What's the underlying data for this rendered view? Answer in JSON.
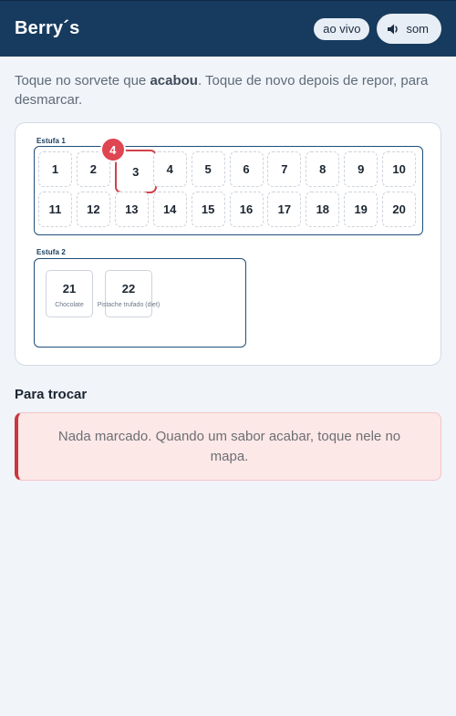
{
  "header": {
    "brand": "Berry´s",
    "live_label": "ao vivo",
    "sound_label": "som",
    "sound_icon": "speaker-icon"
  },
  "instructions": {
    "before": "Toque no sorvete que ",
    "bold": "acabou",
    "after": ". Toque de novo depois de repor, para desmarcar."
  },
  "map": {
    "estufa1": {
      "label": "Estufa 1",
      "cells": [
        "1",
        "2",
        "3",
        "4",
        "5",
        "6",
        "7",
        "8",
        "9",
        "10",
        "11",
        "12",
        "13",
        "14",
        "15",
        "16",
        "17",
        "18",
        "19",
        "20"
      ],
      "selected_cell": "3",
      "selected_badge": "4"
    },
    "estufa2": {
      "label": "Estufa 2",
      "cells": [
        {
          "number": "21",
          "flavor": "Chocolate"
        },
        {
          "number": "22",
          "flavor": "Pistache trufado (diet)"
        }
      ]
    }
  },
  "swap": {
    "title": "Para trocar",
    "empty_message": "Nada marcado. Quando um sabor acabar, toque nele no mapa."
  },
  "colors": {
    "header_bg": "#173b5e",
    "accent_red": "#e04552",
    "estufa_border": "#1f4e7a"
  }
}
